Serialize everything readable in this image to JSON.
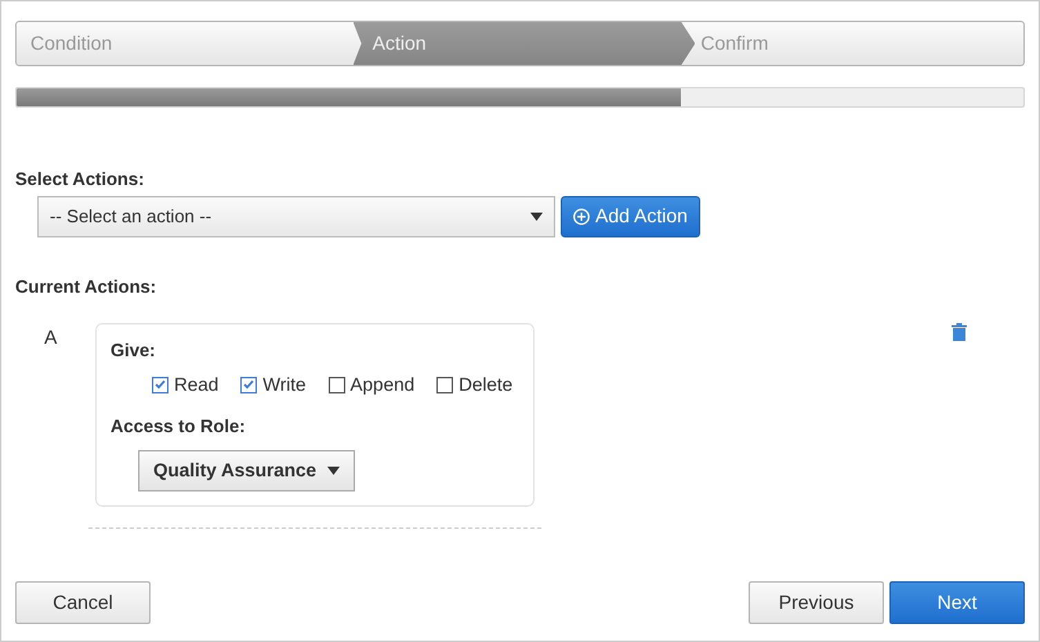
{
  "steps": [
    {
      "label": "Condition",
      "selected": false
    },
    {
      "label": "Action",
      "selected": true
    },
    {
      "label": "Confirm",
      "selected": false
    }
  ],
  "progress": {
    "level": 0.66
  },
  "select_actions": {
    "label": "Select Actions:",
    "dropdown": "-- Select an action --",
    "add_button": "Add Action"
  },
  "current_actions": {
    "label": "Current Actions:",
    "items": [
      {
        "letter": "A",
        "give_label": "Give:",
        "permissions": [
          {
            "label": "Read",
            "checked": true
          },
          {
            "label": "Write",
            "checked": true
          },
          {
            "label": "Append",
            "checked": false
          },
          {
            "label": "Delete",
            "checked": false
          }
        ],
        "role_label": "Access to Role:",
        "role": "Quality Assurance"
      }
    ]
  },
  "buttons": {
    "cancel": "Cancel",
    "previous": "Previous",
    "next": "Next"
  }
}
